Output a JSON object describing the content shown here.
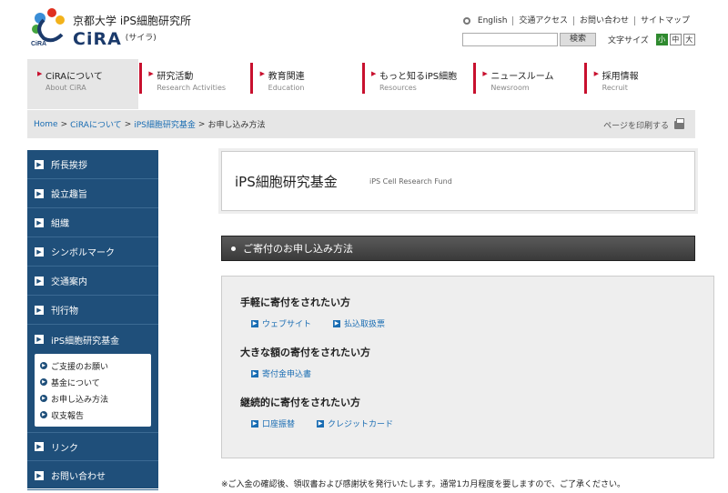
{
  "header": {
    "org_jp": "京都大学 iPS細胞研究所",
    "org_en": "CiRA",
    "org_kana": "(サイラ)",
    "logo_mark": "CiRA",
    "utility": [
      "English",
      "交通アクセス",
      "お問い合わせ",
      "サイトマップ"
    ],
    "search_button": "検索",
    "fontsize_label": "文字サイズ",
    "fontsize_options": [
      "小",
      "中",
      "大"
    ],
    "fontsize_selected": "小"
  },
  "nav": [
    {
      "jp": "CiRAについて",
      "en": "About CiRA"
    },
    {
      "jp": "研究活動",
      "en": "Research Activities"
    },
    {
      "jp": "教育関連",
      "en": "Education"
    },
    {
      "jp": "もっと知るiPS細胞",
      "en": "Resources"
    },
    {
      "jp": "ニュースルーム",
      "en": "Newsroom"
    },
    {
      "jp": "採用情報",
      "en": "Recruit"
    }
  ],
  "breadcrumb": {
    "items": [
      "Home",
      "CiRAについて",
      "iPS細胞研究基金"
    ],
    "current": "お申し込み方法",
    "separator": ">"
  },
  "print_label": "ページを印刷する",
  "sidebar": {
    "items_top": [
      "所長挨拶",
      "設立趣旨",
      "組織",
      "シンボルマーク",
      "交通案内",
      "刊行物"
    ],
    "open_item": "iPS細胞研究基金",
    "sub_items": [
      "ご支援のお願い",
      "基金について",
      "お申し込み方法",
      "収支報告"
    ],
    "items_bottom": [
      "リンク",
      "お問い合わせ"
    ]
  },
  "main": {
    "title": "iPS細胞研究基金",
    "title_en": "iPS Cell Research Fund",
    "section_title": "ご寄付のお申し込み方法",
    "groups": [
      {
        "title": "手軽に寄付をされたい方",
        "links": [
          "ウェブサイト",
          "払込取扱票"
        ]
      },
      {
        "title": "大きな額の寄付をされたい方",
        "links": [
          "寄付金申込書"
        ]
      },
      {
        "title": "継続的に寄付をされたい方",
        "links": [
          "口座振替",
          "クレジットカード"
        ]
      }
    ],
    "note": "※ご入金の確認後、領収書および感謝状を発行いたします。通常1カ月程度を要しますので、ご了承ください。"
  },
  "colors": {
    "accent_red": "#c8102e",
    "sidebar_blue": "#1f4f7a",
    "link_blue": "#1a6db3",
    "fontsize_active_green": "#2f8a2f"
  }
}
